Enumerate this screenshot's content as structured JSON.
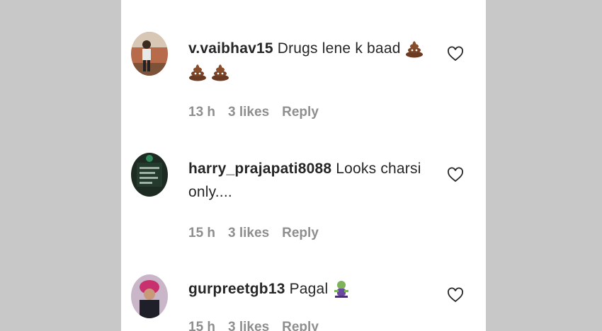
{
  "comments": [
    {
      "username": "v.vaibhav15",
      "text": "Drugs lene k baad",
      "emojis": [
        "poop-emoji",
        "poop-emoji",
        "poop-emoji"
      ],
      "time": "13 h",
      "likes": "3 likes",
      "reply": "Reply"
    },
    {
      "username": "harry_prajapati8088",
      "text": "Looks charsi only....",
      "time": "15 h",
      "likes": "3 likes",
      "reply": "Reply"
    },
    {
      "username": "gurpreetgb13",
      "text": "Pagal",
      "emojis": [
        "zombie-emoji"
      ],
      "time": "15 h",
      "likes": "3 likes",
      "reply": "Reply"
    }
  ],
  "colors": {
    "text": "#262626",
    "meta": "#8e8e8e",
    "background": "#c8c8c8",
    "panel": "#ffffff"
  }
}
